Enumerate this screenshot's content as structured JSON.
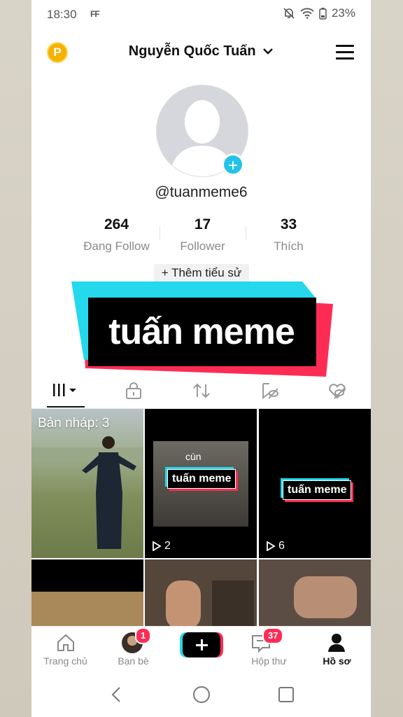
{
  "status_bar": {
    "time": "18:30",
    "indicator": "FF",
    "battery": "23%"
  },
  "header": {
    "account_name": "Nguyễn Quốc Tuấn",
    "coin_letter": "P"
  },
  "profile": {
    "username": "@tuanmeme6",
    "stats": [
      {
        "value": "264",
        "label": "Đang Follow"
      },
      {
        "value": "17",
        "label": "Follower"
      },
      {
        "value": "33",
        "label": "Thích"
      }
    ],
    "bio_button": "+ Thêm tiểu sử",
    "banner_text": "tuấn meme"
  },
  "tabs": [
    "videos-icon",
    "lock-icon",
    "repost-icon",
    "saved-icon",
    "liked-icon"
  ],
  "videos": {
    "draft_label": "Bản nháp: 3",
    "items": [
      {
        "views": "2",
        "caption_top": "cún",
        "badge": "tuấn meme"
      },
      {
        "views": "6",
        "badge": "tuấn meme"
      }
    ]
  },
  "bottom_nav": [
    {
      "label": "Trang chủ"
    },
    {
      "label": "Bạn bè",
      "badge": "1"
    },
    {
      "label": ""
    },
    {
      "label": "Hộp thư",
      "badge": "37"
    },
    {
      "label": "Hồ sơ"
    }
  ],
  "colors": {
    "cyan": "#25d8ec",
    "red": "#fe2c55",
    "coin": "#f6b200"
  }
}
